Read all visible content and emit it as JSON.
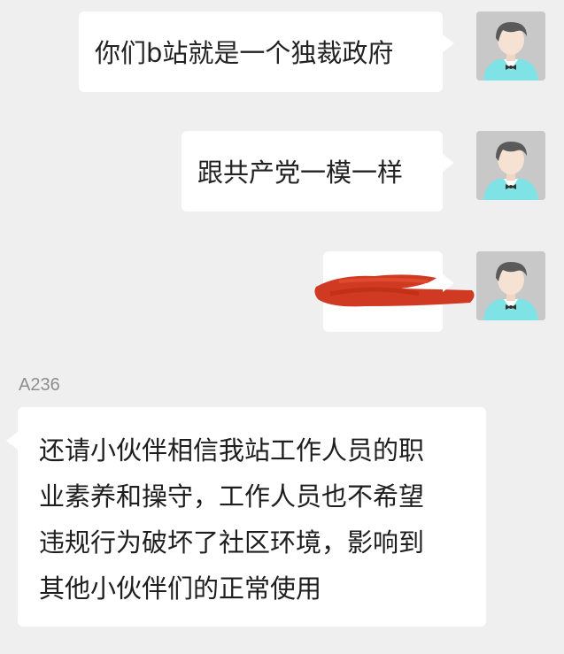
{
  "messages": [
    {
      "side": "right",
      "text": "你们b站就是一个独裁政府",
      "avatar_icon": "user-avatar-icon"
    },
    {
      "side": "right",
      "text": "跟共产党一模一样",
      "avatar_icon": "user-avatar-icon"
    },
    {
      "side": "right",
      "redacted": true,
      "avatar_icon": "user-avatar-icon"
    },
    {
      "side": "left",
      "sender": "A236",
      "lines": [
        "还请小伙伴相信我站工作人员的职",
        "业素养和操守，工作人员也不希望",
        "违规行为破坏了社区环境，影响到",
        "其他小伙伴们的正常使用"
      ]
    }
  ],
  "colors": {
    "background": "#efefef",
    "bubble": "#ffffff",
    "redaction": "#d13a22",
    "avatar_bg": "#c8c8c8",
    "avatar_shirt": "#7fe3e6"
  }
}
